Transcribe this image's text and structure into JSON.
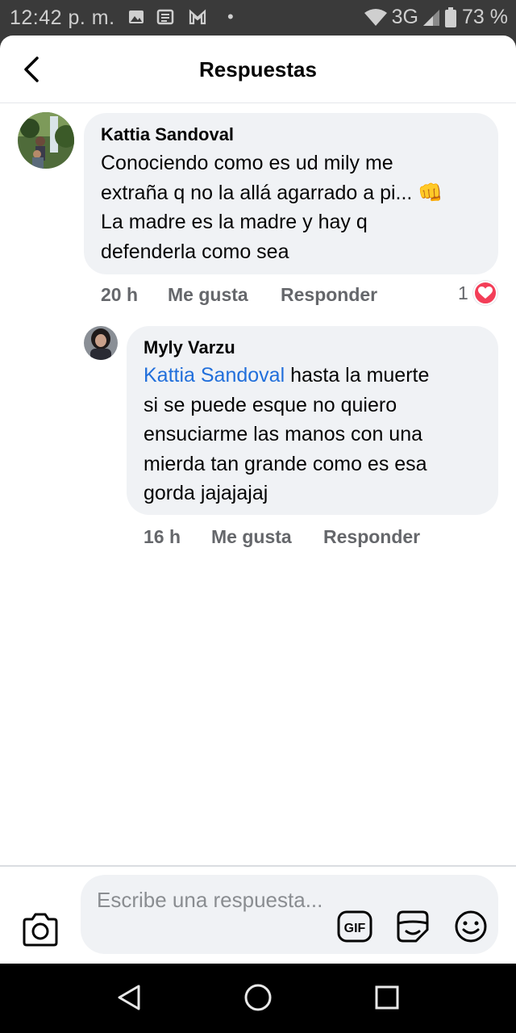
{
  "status_bar": {
    "time": "12:42 p. m.",
    "network": "3G",
    "battery": "73 %"
  },
  "header": {
    "title": "Respuestas"
  },
  "comments": [
    {
      "author": "Kattia Sandoval",
      "lines": [
        "Conociendo como es ud mily me",
        "extraña q no la allá agarrado a pi... 👊",
        "La madre es la madre y hay q",
        "defenderla como sea"
      ],
      "time": "20 h",
      "like_label": "Me gusta",
      "reply_label": "Responder",
      "reaction_count": "1"
    },
    {
      "author": "Myly Varzu",
      "mention": "Kattia Sandoval",
      "first_line_rest": " hasta la muerte",
      "lines": [
        "si se puede esque no quiero",
        "ensuciarme las manos con una",
        "mierda tan grande como es esa",
        "gorda jajajajaj"
      ],
      "time": "16 h",
      "like_label": "Me gusta",
      "reply_label": "Responder"
    }
  ],
  "composer": {
    "placeholder": "Escribe una respuesta...",
    "gif_label": "GIF"
  },
  "colors": {
    "mention": "#216fdb",
    "bubble": "#f0f2f5",
    "meta": "#65676b",
    "heart": "#f33e58"
  }
}
